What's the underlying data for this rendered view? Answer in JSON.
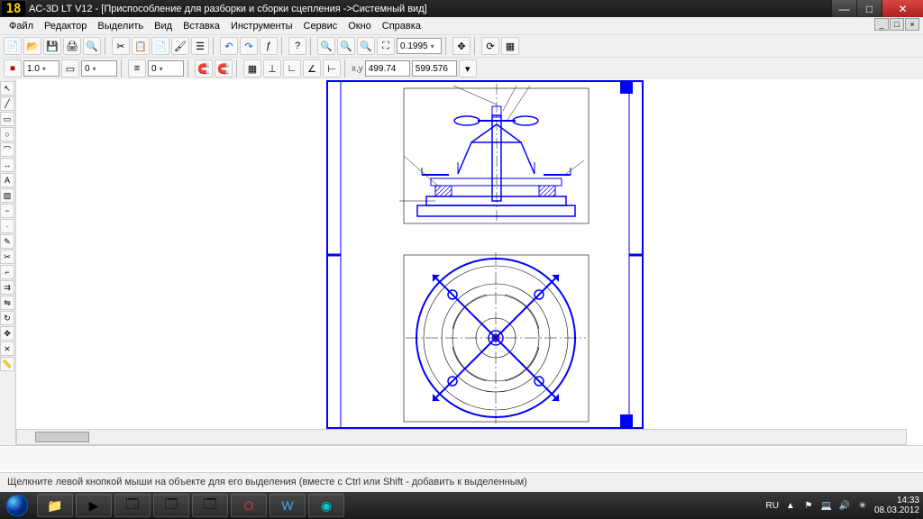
{
  "title": {
    "num": "18",
    "text": "AC-3D LT V12 - [Приспособление для разборки и сборки сцепления ->Системный вид]"
  },
  "menu": [
    "Файл",
    "Редактор",
    "Выделить",
    "Вид",
    "Вставка",
    "Инструменты",
    "Сервис",
    "Окно",
    "Справка"
  ],
  "tb1": {
    "zoom": "0.1995"
  },
  "tb2": {
    "v1": "1.0",
    "v2": "0",
    "v3": "0",
    "coord_x": "499.74",
    "coord_y": "599.576"
  },
  "status": "Щелкните левой кнопкой мыши на объекте для его выделения (вместе с Ctrl или Shift - добавить к выделенным)",
  "tray": {
    "lang": "RU",
    "time": "14:33",
    "date": "08.03.2012"
  }
}
